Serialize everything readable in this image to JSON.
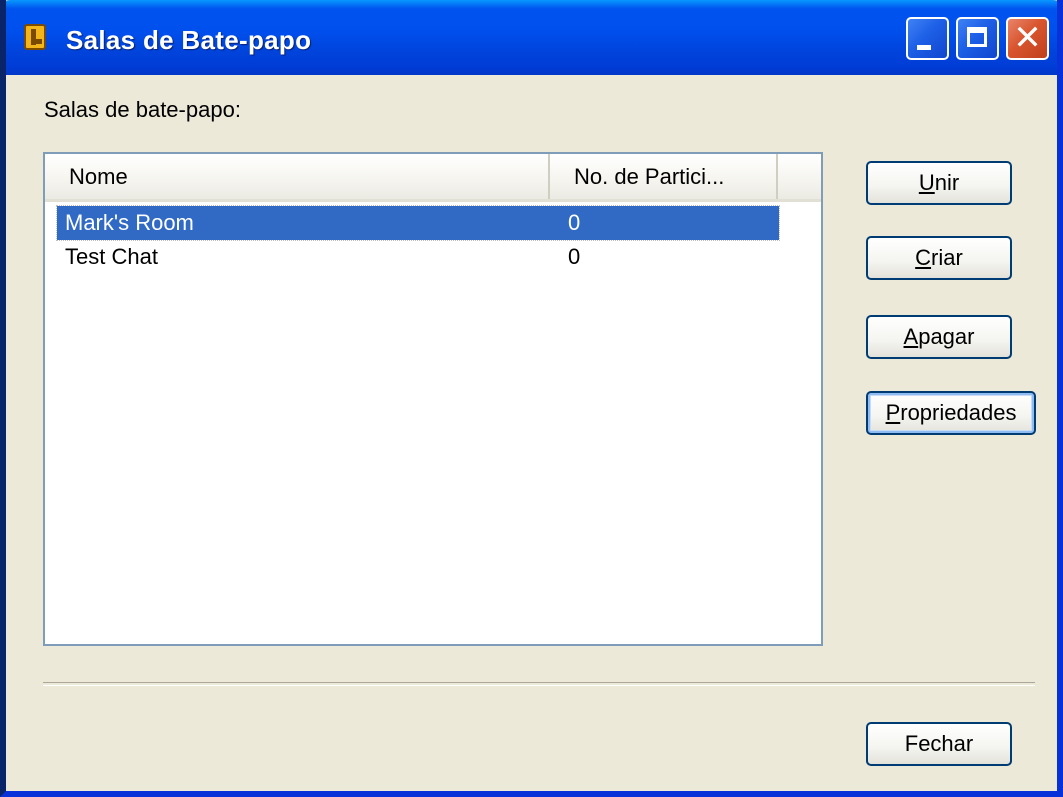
{
  "window": {
    "title": "Salas de Bate-papo"
  },
  "titlebar_buttons": {
    "minimize_icon": "minimize-icon",
    "maximize_icon": "maximize-icon",
    "close_icon": "close-icon",
    "close_glyph": "✕"
  },
  "rooms_label": "Salas de bate-papo:",
  "list": {
    "columns": [
      "Nome",
      "No. de Partici..."
    ],
    "rows": [
      {
        "name": "Mark's Room",
        "count": "0",
        "selected": true
      },
      {
        "name": "Test Chat",
        "count": "0",
        "selected": false
      }
    ]
  },
  "buttons": {
    "join": {
      "accel": "U",
      "rest": "nir"
    },
    "create": {
      "accel": "C",
      "rest": "riar"
    },
    "delete": {
      "accel": "A",
      "rest": "pagar"
    },
    "properties": {
      "accel": "P",
      "rest": "ropriedades"
    },
    "close": "Fechar"
  },
  "colors": {
    "titlebar": "#0053ee",
    "selection": "#316ac5",
    "dialog_bg": "#ece9d8"
  }
}
